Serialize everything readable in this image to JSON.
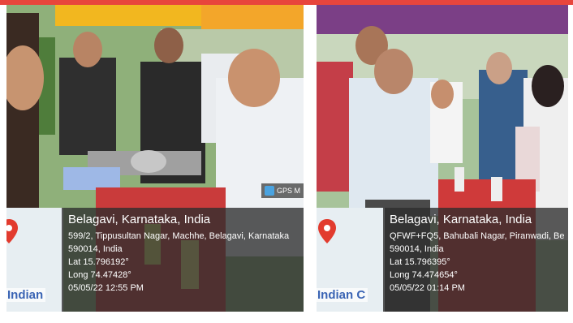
{
  "left_photo": {
    "place": "Belagavi, Karnataka, India",
    "address_line1": "599/2, Tippusultan Nagar, Machhe, Belagavi, Karnataka",
    "address_line2": "590014, India",
    "lat": "Lat 15.796192°",
    "long": "Long 74.47428°",
    "datetime": "05/05/22 12:55 PM",
    "gps_tag": "GPS M",
    "map_brand": "Indian"
  },
  "right_photo": {
    "place": "Belagavi, Karnataka, India",
    "address_line1": "QFWF+FQ5, Bahubali Nagar, Piranwadi, Be",
    "address_line2": "590014, India",
    "lat": "Lat 15.796395°",
    "long": "Long 74.474654°",
    "datetime": "05/05/22 01:14 PM",
    "map_brand": "Indian C"
  },
  "colors": {
    "banner": "#e8453c",
    "overlay": "#2d2d2d",
    "pin": "#e23b2e"
  }
}
